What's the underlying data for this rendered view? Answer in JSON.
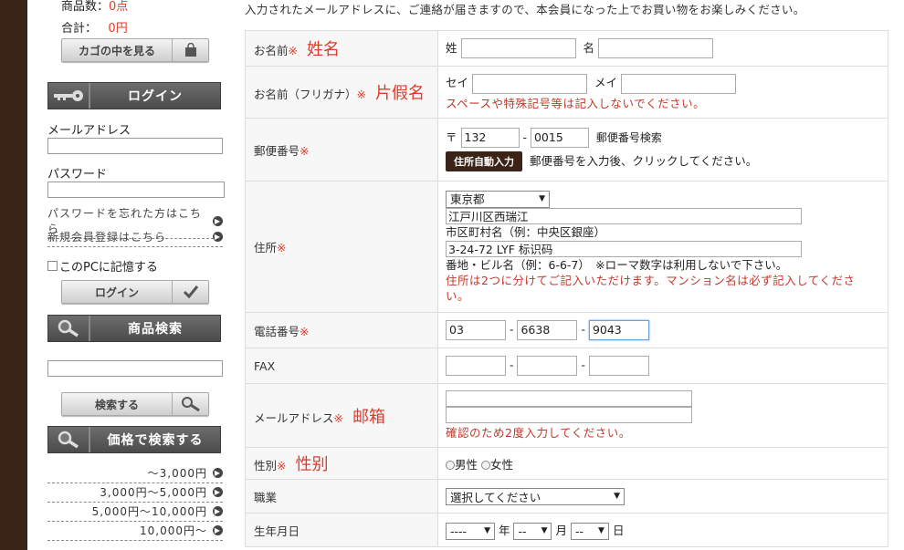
{
  "sidebar": {
    "count_label": "商品数：",
    "count_value": "0点",
    "total_label": "合計：",
    "total_value": "0円",
    "cart_button": "カゴの中を見る",
    "login_heading": "ログイン",
    "email_label": "メールアドレス",
    "password_label": "パスワード",
    "forgot_link": "パスワードを忘れた方はこちら",
    "register_link": "新規会員登録はこちら",
    "remember_label": "このPCに記憶する",
    "login_button": "ログイン",
    "search_heading": "商品検索",
    "search_button": "検索する",
    "price_heading": "価格で検索する",
    "price_ranges": [
      "～3,000円",
      "3,000円～5,000円",
      "5,000円～10,000円",
      "10,000円～"
    ]
  },
  "main": {
    "intro": "入力されたメールアドレスに、ご連絡が届きますので、本会員になった上でお買い物をお楽しみください。",
    "required_mark": "※",
    "name": {
      "label": "お名前",
      "annotation": "姓名",
      "last_label": "姓",
      "first_label": "名"
    },
    "kana": {
      "label": "お名前（フリガナ）",
      "annotation": "片假名",
      "last_label": "セイ",
      "first_label": "メイ",
      "note": "スペースや特殊記号等は記入しないでください。"
    },
    "zip": {
      "label": "郵便番号",
      "prefix": "〒",
      "zip1": "132",
      "zip2": "0015",
      "search_link": "郵便番号検索",
      "auto_button": "住所自動入力",
      "auto_note": "郵便番号を入力後、クリックしてください。"
    },
    "address": {
      "label": "住所",
      "prefecture": "東京都",
      "addr1": "江戸川区西瑞江",
      "addr1_hint": "市区町村名（例：中央区銀座）",
      "addr2": "3-24-72 LYF 标识码",
      "addr2_hint": "番地・ビル名（例：6-6-7）　※ローマ数字は利用しないで下さい。",
      "note": "住所は2つに分けてご記入いただけます。マンション名は必ず記入してください。"
    },
    "phone": {
      "label": "電話番号",
      "p1": "03",
      "p2": "6638",
      "p3": "9043"
    },
    "fax": {
      "label": "FAX"
    },
    "email": {
      "label": "メールアドレス",
      "annotation": "邮箱",
      "note": "確認のため2度入力してください。"
    },
    "gender": {
      "label": "性別",
      "annotation": "性别",
      "male": "男性",
      "female": "女性"
    },
    "job": {
      "label": "職業",
      "placeholder": "選択してください"
    },
    "birthday": {
      "label": "生年月日",
      "year_value": "----",
      "year_unit": "年",
      "month_value": "--",
      "month_unit": "月",
      "day_value": "--",
      "day_unit": "日"
    }
  }
}
